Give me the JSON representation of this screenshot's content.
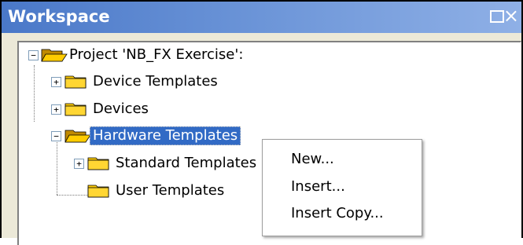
{
  "window": {
    "title": "Workspace",
    "restore_icon": "restore-box-icon",
    "close_icon": "close-x-icon",
    "close_glyph": "×"
  },
  "tree": {
    "root": {
      "label": "Project 'NB_FX Exercise':",
      "expander": "−",
      "expanded": true
    },
    "items": [
      {
        "label": "Device Templates",
        "expander": "+",
        "expanded": false
      },
      {
        "label": "Devices",
        "expander": "+",
        "expanded": false
      },
      {
        "label": "Hardware Templates",
        "expander": "−",
        "expanded": true,
        "selected": true
      },
      {
        "label": "Standard Templates",
        "expander": "+",
        "expanded": false
      },
      {
        "label": "User Templates",
        "expanded": false
      }
    ]
  },
  "context_menu": {
    "items": [
      {
        "label": "New..."
      },
      {
        "label": "Insert..."
      },
      {
        "label": "Insert Copy..."
      }
    ]
  },
  "colors": {
    "titlebar_start": "#4a78c8",
    "titlebar_end": "#8fb0e6",
    "selection": "#316ac5",
    "folder_fill": "#ffcc00",
    "folder_shadow": "#c08a00",
    "panel_bg": "#ece9d8"
  }
}
